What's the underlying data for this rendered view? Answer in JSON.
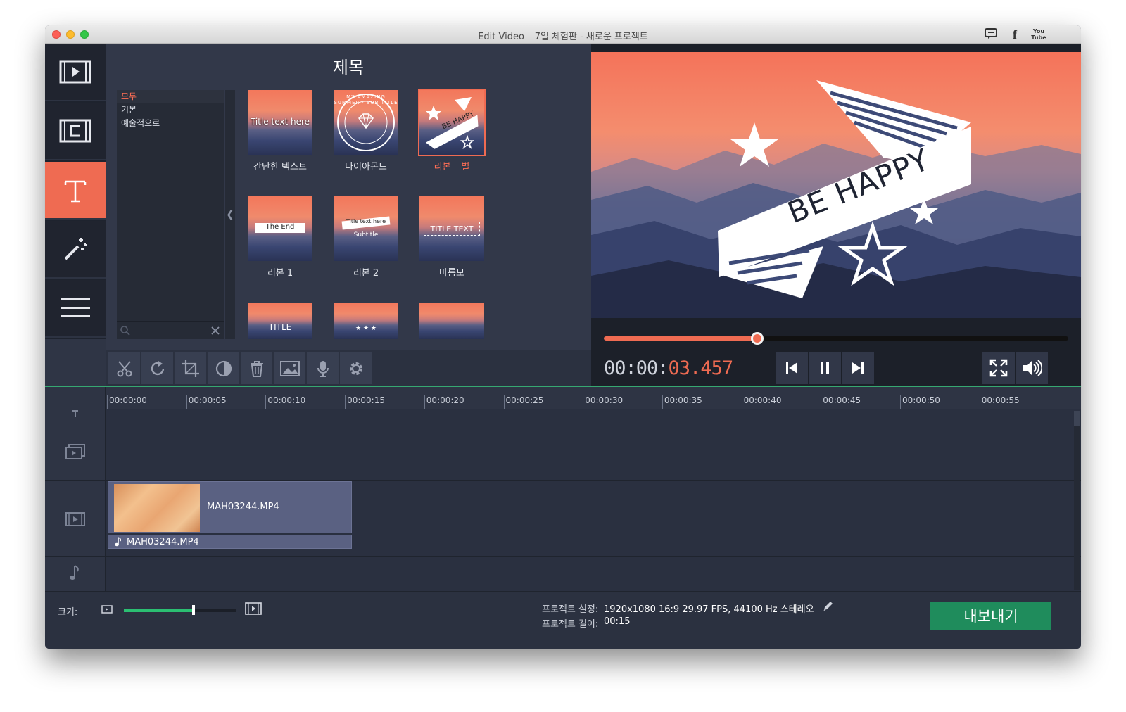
{
  "window": {
    "title": "Edit Video – 7일 체험판 - 새로운 프로젝트"
  },
  "titlebar_icons": [
    "chat-icon",
    "facebook-icon",
    "youtube-icon"
  ],
  "youtube_label": "You Tube",
  "sidebar": {
    "items": [
      {
        "name": "import-media",
        "icon": "film-play-icon",
        "active": false
      },
      {
        "name": "transitions",
        "icon": "film-transition-icon",
        "active": false
      },
      {
        "name": "titles",
        "icon": "text-t-icon",
        "active": true
      },
      {
        "name": "filters",
        "icon": "magic-wand-icon",
        "active": false
      },
      {
        "name": "more",
        "icon": "hamburger-menu-icon",
        "active": false
      }
    ]
  },
  "titles_panel": {
    "heading": "제목",
    "categories": [
      {
        "label": "모두",
        "selected": true
      },
      {
        "label": "기본",
        "selected": false
      },
      {
        "label": "예술적으로",
        "selected": false
      }
    ],
    "thumbnails": [
      {
        "label": "간단한 텍스트",
        "overlay": "Title text here",
        "selected": false
      },
      {
        "label": "다이아몬드",
        "overlay": "MY AMAZING SUMMER · SUB TITLE",
        "selected": false
      },
      {
        "label": "리본 – 별",
        "overlay": "BE HAPPY",
        "selected": true
      },
      {
        "label": "리본 1",
        "overlay": "The End",
        "selected": false
      },
      {
        "label": "리본 2",
        "overlay": "Title text here",
        "overlay2": "Subtitle",
        "selected": false
      },
      {
        "label": "마름모",
        "overlay": "TITLE TEXT",
        "selected": false
      },
      {
        "label": "",
        "overlay": "TITLE",
        "selected": false
      },
      {
        "label": "",
        "overlay": "★ ★ ★",
        "selected": false
      },
      {
        "label": "",
        "overlay": "",
        "selected": false
      }
    ]
  },
  "toolbar": {
    "tools": [
      "scissors-icon",
      "rotate-icon",
      "crop-icon",
      "color-adjust-icon",
      "trash-icon",
      "image-icon",
      "microphone-icon",
      "gear-icon"
    ]
  },
  "preview": {
    "overlay_text": "BE HAPPY",
    "progress": 0.33,
    "time_dim": "00:00:",
    "time_hot": "03.457"
  },
  "timeline": {
    "ticks": [
      "00:00:00",
      "00:00:05",
      "00:00:10",
      "00:00:15",
      "00:00:20",
      "00:00:25",
      "00:00:30",
      "00:00:35",
      "00:00:40",
      "00:00:45",
      "00:00:50",
      "00:00:55"
    ],
    "video_clip": "MAH03244.MP4",
    "audio_clip": "MAH03244.MP4"
  },
  "bottom": {
    "size_label": "크기:",
    "zoom_level": 0.62,
    "settings_label": "프로젝트 설정:",
    "settings_value": "1920x1080 16:9 29.97 FPS, 44100 Hz 스테레오",
    "length_label": "프로젝트 길이:",
    "length_value": "00:15",
    "export_label": "내보내기"
  },
  "colors": {
    "accent": "#ef6b52",
    "export": "#1f8c5c",
    "timeline_line": "#36a871",
    "background": "#2b3140"
  }
}
